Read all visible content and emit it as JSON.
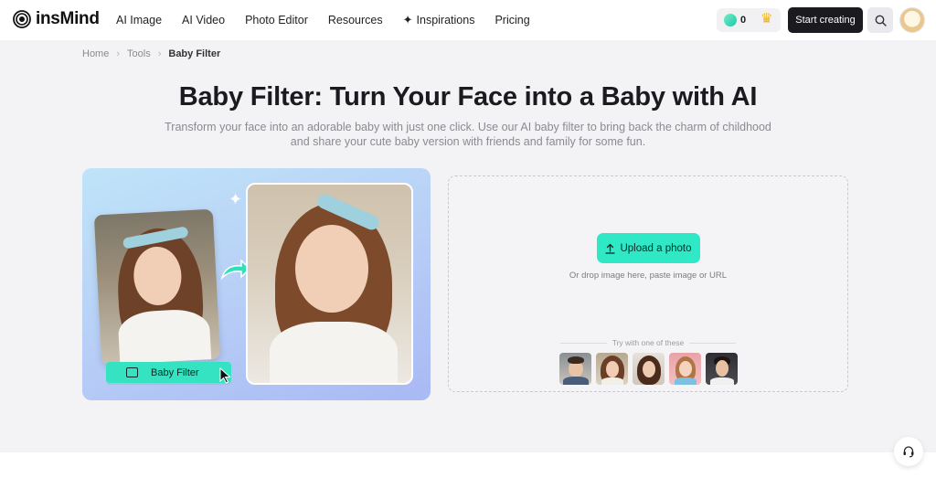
{
  "brand": {
    "name": "insMind"
  },
  "nav": {
    "items": [
      {
        "label": "AI Image"
      },
      {
        "label": "AI Video"
      },
      {
        "label": "Photo Editor"
      },
      {
        "label": "Resources"
      },
      {
        "label": "Inspirations"
      },
      {
        "label": "Pricing"
      }
    ]
  },
  "header": {
    "credits": "0",
    "start_label": "Start creating"
  },
  "breadcrumb": {
    "home": "Home",
    "tools": "Tools",
    "current": "Baby Filter"
  },
  "hero": {
    "title": "Baby Filter: Turn Your Face into a Baby with AI",
    "subtitle": "Transform your face into an adorable baby with just one click. Use our AI baby filter to bring back the charm of childhood and share your cute baby version with friends and family for some fun."
  },
  "showcase": {
    "pill_label": "Baby Filter"
  },
  "upload": {
    "button_label": "Upload a photo",
    "hint": "Or drop image here, paste image or URL",
    "try_label": "Try with one of these"
  },
  "colors": {
    "accent": "#2ee8c6",
    "dark_button": "#1b1b1f"
  }
}
